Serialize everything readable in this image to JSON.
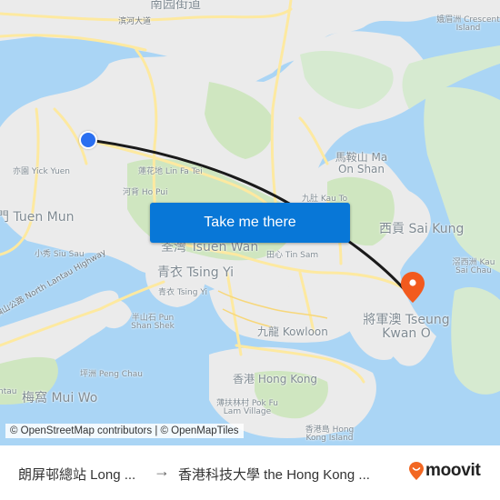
{
  "map": {
    "labels": [
      {
        "id": "nanyuan",
        "text": "南园街道",
        "size": "lg"
      },
      {
        "id": "binhe",
        "text": "滨河大道",
        "size": "sm"
      },
      {
        "id": "crescent",
        "text": "娥眉洲 Crescent Island",
        "size": "sm"
      },
      {
        "id": "yick-yuen",
        "text": "亦園 Yick Yuen",
        "size": "sm"
      },
      {
        "id": "lin-fa-tei",
        "text": "蓮花地 Lin Fa Tei",
        "size": "sm"
      },
      {
        "id": "ho-pui",
        "text": "河背 Ho Pui",
        "size": "sm"
      },
      {
        "id": "tuen-mun",
        "text": "門 Tuen Mun",
        "size": "lg"
      },
      {
        "id": "siu-sau",
        "text": "小秀 Siu Sau",
        "size": "sm"
      },
      {
        "id": "tsuen-wan",
        "text": "荃灣 Tsuen Wan",
        "size": "lg"
      },
      {
        "id": "ma-on-shan",
        "text": "馬鞍山 Ma On Shan",
        "size": "md"
      },
      {
        "id": "kau-to",
        "text": "九肚 Kau To",
        "size": "sm"
      },
      {
        "id": "sai-kung",
        "text": "西貢 Sai Kung",
        "size": "lg"
      },
      {
        "id": "tin-sam",
        "text": "田心 Tin Sam",
        "size": "sm"
      },
      {
        "id": "kau-sai-chau",
        "text": "滘西洲 Kau Sai Chau",
        "size": "sm"
      },
      {
        "id": "tsing-yi-big",
        "text": "青衣 Tsing Yi",
        "size": "lg"
      },
      {
        "id": "tsing-yi-small",
        "text": "青衣 Tsing Yi",
        "size": "sm"
      },
      {
        "id": "north-lantau-hwy",
        "text": "北大嶼山公路 North Lantau Highway",
        "size": "sm"
      },
      {
        "id": "pun-shan-shek",
        "text": "半山石 Pun Shan Shek",
        "size": "sm"
      },
      {
        "id": "kowloon",
        "text": "九龍 Kowloon",
        "size": "md"
      },
      {
        "id": "tseung-kwan-o",
        "text": "將軍澳 Tseung Kwan O",
        "size": "lg"
      },
      {
        "id": "peng-chau",
        "text": "坪洲 Peng Chau",
        "size": "sm"
      },
      {
        "id": "hong-kong",
        "text": "香港 Hong Kong",
        "size": "md"
      },
      {
        "id": "pok-fu-lam",
        "text": "薄扶林村 Pok Fu Lam Village",
        "size": "sm"
      },
      {
        "id": "mui-wo",
        "text": "梅窩 Mui Wo",
        "size": "lg"
      },
      {
        "id": "lantau",
        "text": "ntau",
        "size": "sm"
      },
      {
        "id": "hk-island",
        "text": "香港島 Hong Kong Island",
        "size": "sm"
      }
    ],
    "origin_marker": {
      "name": "Long Ping Bus Terminus",
      "color": "#2a6ff0"
    },
    "destination_marker": {
      "name": "HKUST",
      "color": "#f25a1e"
    },
    "route_color": "#1a1a1a",
    "cta_label": "Take me there",
    "attribution": "© OpenStreetMap contributors | © OpenMapTiles"
  },
  "footer": {
    "from": "朗屏邨總站 Long ...",
    "arrow": "→",
    "to": "香港科技大學 the Hong Kong ...",
    "brand": "moovit",
    "brand_color": "#f26722"
  }
}
